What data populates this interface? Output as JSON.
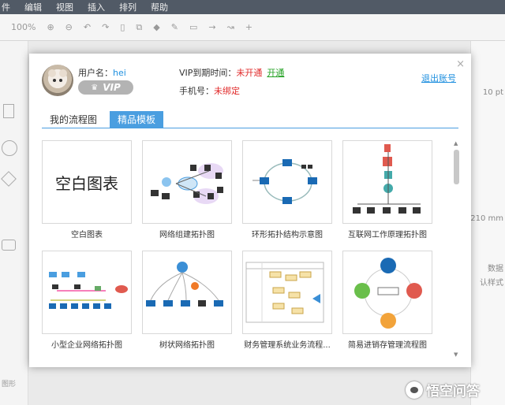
{
  "menubar": {
    "items": [
      "件",
      "编辑",
      "视图",
      "插入",
      "排列",
      "帮助"
    ]
  },
  "toolbar": {
    "zoom": "100%"
  },
  "right_panel": {
    "text1": "10 pt",
    "text2": "210 mm",
    "text3": "数据",
    "text4": "认样式"
  },
  "left_panel": {
    "bottom_text": "图形"
  },
  "dialog": {
    "close": "×",
    "username_label": "用户名：",
    "username": "hei",
    "vip_badge": "VIP",
    "vip_expire_label": "VIP到期时间：",
    "vip_expire_value": "未开通",
    "activate_link": "开通",
    "phone_label": "手机号：",
    "phone_value": "未绑定",
    "logout": "退出账号",
    "tabs": [
      {
        "label": "我的流程图",
        "active": false
      },
      {
        "label": "精品模板",
        "active": true
      }
    ],
    "blank_thumb_text": "空白图表",
    "templates": [
      {
        "caption": "空白图表"
      },
      {
        "caption": "网络组建拓扑图"
      },
      {
        "caption": "环形拓扑结构示意图"
      },
      {
        "caption": "互联网工作原理拓扑图"
      },
      {
        "caption": "小型企业网络拓扑图"
      },
      {
        "caption": "树状网络拓扑图"
      },
      {
        "caption": "财务管理系统业务流程..."
      },
      {
        "caption": "简易进销存管理流程图"
      }
    ]
  },
  "watermark": {
    "text": "悟空问答"
  },
  "colors": {
    "accent": "#4a9ee0",
    "link": "#1e8fdf",
    "warn": "#e02828",
    "ok": "#20a020"
  }
}
